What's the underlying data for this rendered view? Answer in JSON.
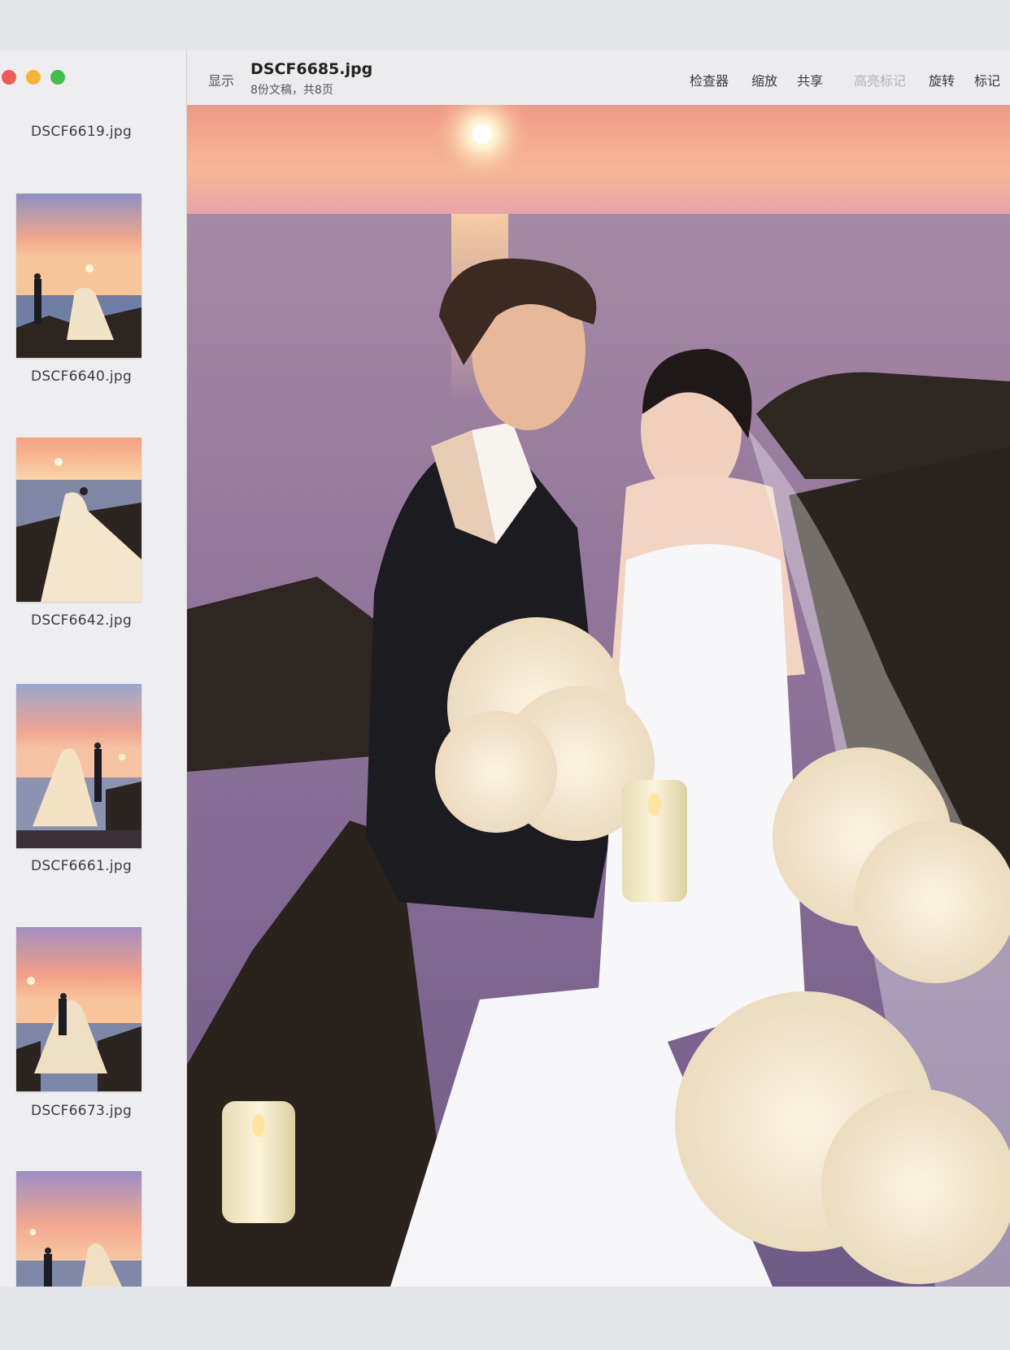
{
  "toolbar": {
    "show_label": "显示",
    "title": "DSCF6685.jpg",
    "subtitle": "8份文稿，共8页",
    "buttons": [
      "检查器",
      "缩放",
      "共享",
      "高亮标记",
      "旋转",
      "标记"
    ],
    "highlight_disabled": true
  },
  "sidebar": {
    "items": [
      {
        "label": "DSCF6619.jpg"
      },
      {
        "label": "DSCF6640.jpg"
      },
      {
        "label": "DSCF6642.jpg"
      },
      {
        "label": "DSCF6661.jpg"
      },
      {
        "label": "DSCF6673.jpg"
      },
      {
        "label": ""
      }
    ]
  },
  "colors": {
    "close": "#ec5c55",
    "minimize": "#f2b637",
    "maximize": "#3ec04a",
    "sky_top": "#f0977e",
    "sea": "#7e6a92"
  },
  "icons": {
    "window_close": "traffic-light-red",
    "window_minimize": "traffic-light-yellow",
    "window_maximize": "traffic-light-green"
  }
}
